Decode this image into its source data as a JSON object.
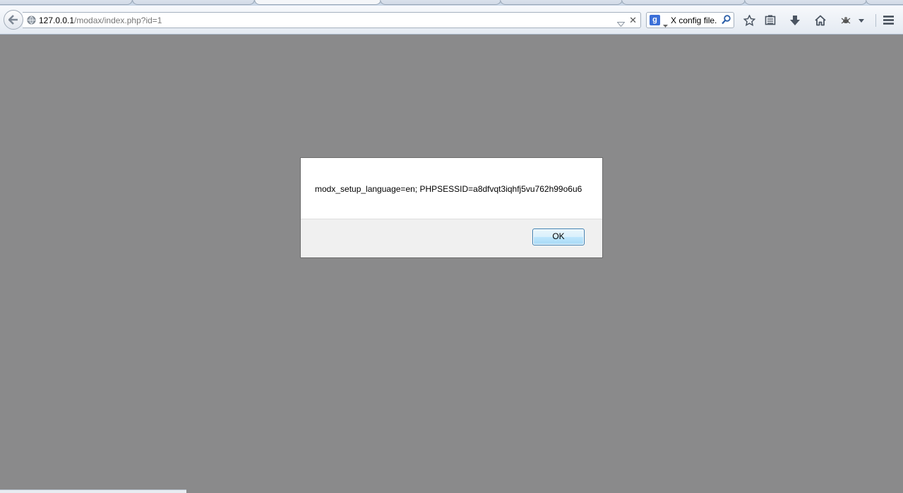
{
  "browser": {
    "url_host": "127.0.0.1",
    "url_path": "/modax/index.php?id=1",
    "search_query": "X config file.",
    "search_engine_letter": "g"
  },
  "dialog": {
    "message": "modx_setup_language=en; PHPSESSID=a8dfvqt3iqhfj5vu762h99o6u6",
    "ok_label": "OK"
  },
  "colors": {
    "page_overlay": "#8a8a8b",
    "ok_border": "#3c7fb1"
  }
}
